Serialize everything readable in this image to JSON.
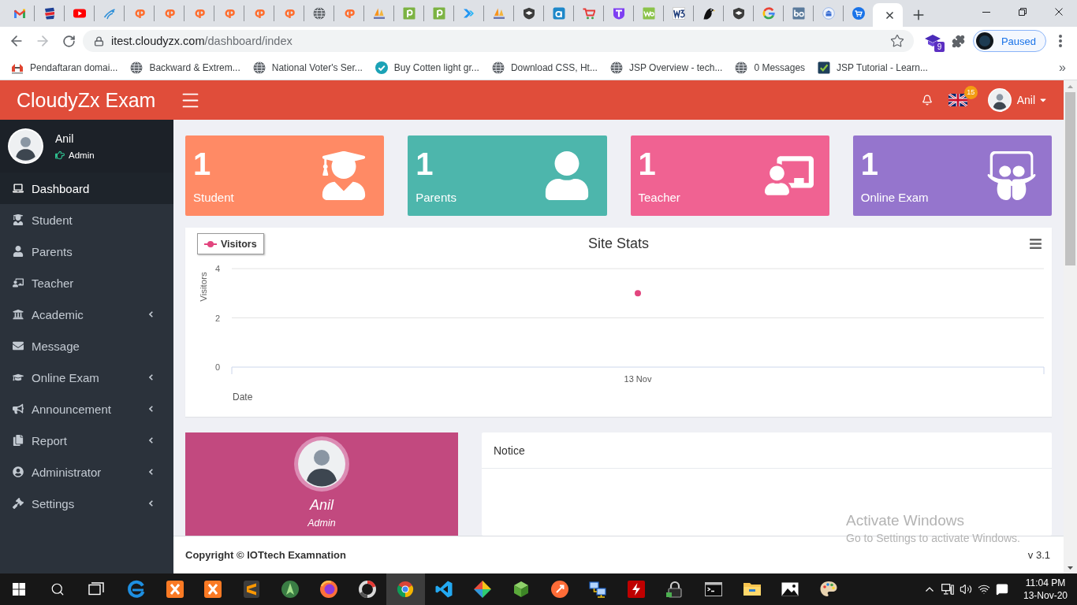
{
  "browser": {
    "tabs": [
      {
        "selected": false
      },
      {
        "selected": false
      },
      {
        "selected": false
      },
      {
        "selected": false
      },
      {
        "selected": false
      },
      {
        "selected": false
      },
      {
        "selected": false
      },
      {
        "selected": false
      },
      {
        "selected": false
      },
      {
        "selected": false
      },
      {
        "selected": false
      },
      {
        "selected": false
      },
      {
        "selected": false
      },
      {
        "selected": false
      },
      {
        "selected": false
      },
      {
        "selected": false
      },
      {
        "selected": false
      },
      {
        "selected": false
      },
      {
        "selected": false
      },
      {
        "selected": false
      },
      {
        "selected": false
      },
      {
        "selected": false
      },
      {
        "selected": false
      },
      {
        "selected": false
      },
      {
        "selected": false
      },
      {
        "selected": false
      },
      {
        "selected": false
      },
      {
        "selected": false
      },
      {
        "selected": false
      },
      {
        "selected": true
      }
    ],
    "history_buttons": [
      {
        "disabled": false
      },
      {
        "disabled": true
      }
    ],
    "address_bar": {
      "host": "itest.cloudyzx.com",
      "path": "/dashboard/index"
    },
    "extension_badge": "9",
    "profile_button": {
      "label": "Paused"
    },
    "bookmarks": [
      {
        "label": "Pendaftaran domai..."
      },
      {
        "label": "Backward & Extrem..."
      },
      {
        "label": "National Voter's Ser..."
      },
      {
        "label": "Buy Cotten light gr..."
      },
      {
        "label": "Download CSS, Ht..."
      },
      {
        "label": "JSP Overview - tech..."
      },
      {
        "label": "0 Messages"
      },
      {
        "label": "JSP Tutorial - Learn..."
      }
    ],
    "bookmarks_more": "»"
  },
  "app": {
    "header": {
      "logo": "CloudyZx Exam",
      "flag_badge": "15",
      "user": "Anil"
    },
    "sidebar": {
      "user": {
        "name": "Anil",
        "role": "Admin"
      },
      "items": [
        {
          "label": "Dashboard",
          "selected": true,
          "submenu": false
        },
        {
          "label": "Student",
          "selected": false,
          "submenu": false
        },
        {
          "label": "Parents",
          "selected": false,
          "submenu": false
        },
        {
          "label": "Teacher",
          "selected": false,
          "submenu": false
        },
        {
          "label": "Academic",
          "selected": false,
          "submenu": true
        },
        {
          "label": "Message",
          "selected": false,
          "submenu": false
        },
        {
          "label": "Online Exam",
          "selected": false,
          "submenu": true
        },
        {
          "label": "Announcement",
          "selected": false,
          "submenu": true
        },
        {
          "label": "Report",
          "selected": false,
          "submenu": true
        },
        {
          "label": "Administrator",
          "selected": false,
          "submenu": true
        },
        {
          "label": "Settings",
          "selected": false,
          "submenu": true
        }
      ]
    },
    "stat_cards": [
      {
        "count": "1",
        "label": "Student",
        "color": "#ff8a65"
      },
      {
        "count": "1",
        "label": "Parents",
        "color": "#4db6ac"
      },
      {
        "count": "1",
        "label": "Teacher",
        "color": "#f06292"
      },
      {
        "count": "1",
        "label": "Online Exam",
        "color": "#9575cd"
      }
    ],
    "site_stats": {
      "chart_data": {
        "type": "line",
        "title": "Site Stats",
        "xlabel": "Date",
        "ylabel": "Visitors",
        "categories": [
          "13 Nov"
        ],
        "series": [
          {
            "name": "Visitors",
            "color": "#e2457e",
            "values": [
              3
            ],
            "marker": true
          }
        ],
        "ylim": [
          0,
          4
        ],
        "yticks": [
          0,
          2,
          4
        ]
      }
    },
    "profile_card": {
      "name": "Anil",
      "role": "Admin"
    },
    "notice": {
      "title": "Notice"
    },
    "footer": {
      "copyright": "Copyright © IOTtech Examnation",
      "version": "v 3.1"
    }
  },
  "os_notice": {
    "title": "Activate Windows",
    "hint": "Go to Settings to activate Windows."
  },
  "taskbar": {
    "apps": [
      {
        "selected": false
      },
      {
        "selected": false
      },
      {
        "selected": false
      },
      {
        "selected": false
      },
      {
        "selected": false
      },
      {
        "selected": false
      },
      {
        "selected": false
      },
      {
        "selected": true
      },
      {
        "selected": false
      },
      {
        "selected": false
      },
      {
        "selected": false
      },
      {
        "selected": false
      },
      {
        "selected": false
      },
      {
        "selected": false
      },
      {
        "selected": false
      },
      {
        "selected": false
      },
      {
        "selected": false
      },
      {
        "selected": false
      },
      {
        "selected": false
      }
    ],
    "time": "11:04 PM",
    "date": "13-Nov-20"
  }
}
